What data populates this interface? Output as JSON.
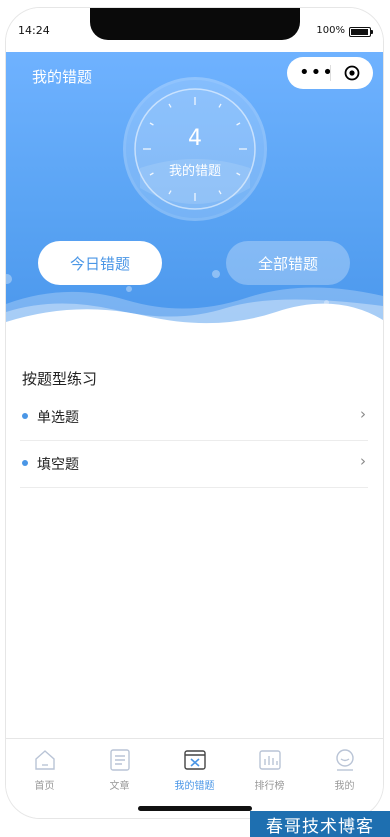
{
  "status": {
    "time": "14:24",
    "battery": "100%"
  },
  "header": {
    "title": "我的错题"
  },
  "summary": {
    "count": "4",
    "label": "我的错题"
  },
  "buttons": {
    "today": "今日错题",
    "all": "全部错题"
  },
  "practice": {
    "title": "按题型练习",
    "items": [
      {
        "label": "单选题"
      },
      {
        "label": "填空题"
      }
    ]
  },
  "tabbar": {
    "items": [
      {
        "label": "首页",
        "icon": "home-icon"
      },
      {
        "label": "文章",
        "icon": "article-icon"
      },
      {
        "label": "我的错题",
        "icon": "wrong-questions-icon"
      },
      {
        "label": "排行榜",
        "icon": "ranking-icon"
      },
      {
        "label": "我的",
        "icon": "profile-icon"
      }
    ],
    "active": 2
  },
  "watermark": "春哥技术博客",
  "colors": {
    "accent": "#4a96e6",
    "hero_top": "#6fb2ff",
    "hero_bottom": "#4b97ec"
  }
}
